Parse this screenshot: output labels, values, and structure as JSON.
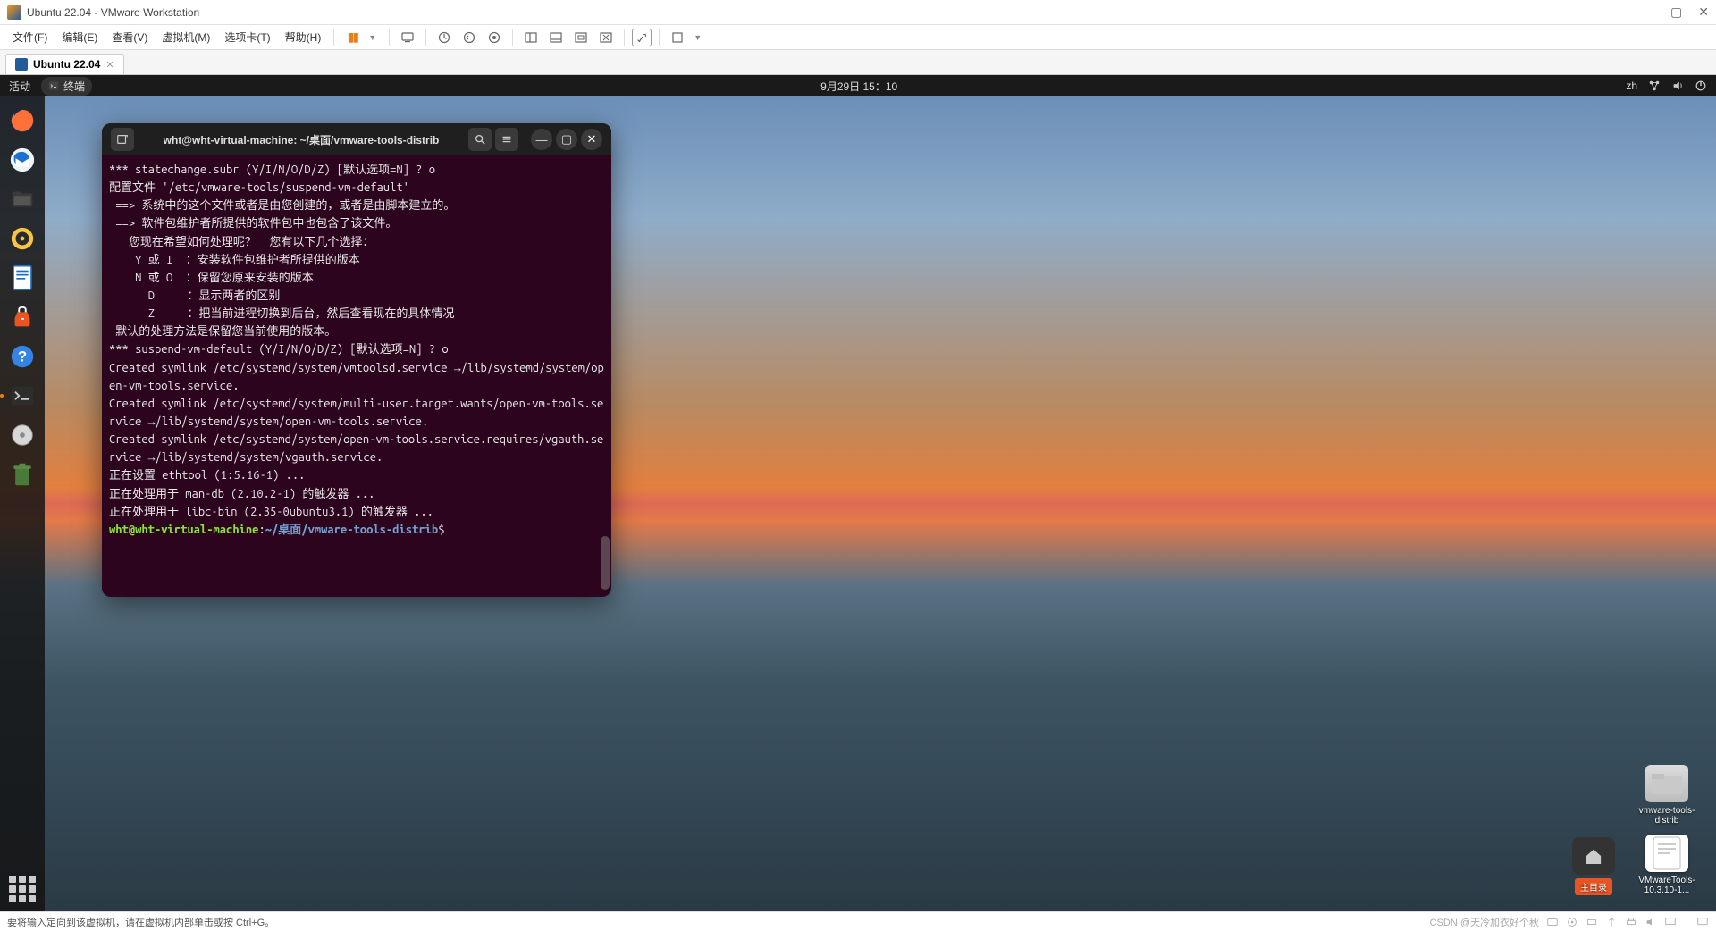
{
  "vmware": {
    "title": "Ubuntu 22.04 - VMware Workstation",
    "menu": {
      "file": "文件(F)",
      "edit": "编辑(E)",
      "view": "查看(V)",
      "vm": "虚拟机(M)",
      "tabs": "选项卡(T)",
      "help": "帮助(H)"
    },
    "tab": {
      "label": "Ubuntu 22.04"
    },
    "status": "要将输入定向到该虚拟机，请在虚拟机内部单击或按 Ctrl+G。",
    "watermark": "CSDN @天冷加衣好个秋"
  },
  "ubuntu": {
    "topbar": {
      "activities": "活动",
      "app": "终端",
      "datetime": "9月29日 15：10",
      "lang": "zh"
    },
    "desktop": {
      "folder1": "vmware-tools-distrib",
      "home": "主目录",
      "file1": "VMwareTools-10.3.10-1..."
    }
  },
  "terminal": {
    "title": "wht@wht-virtual-machine: ~/桌面/vmware-tools-distrib",
    "lines": [
      "*** statechange.subr (Y/I/N/O/D/Z) [默认选项=N] ? o",
      "",
      "配置文件 '/etc/vmware-tools/suspend-vm-default'",
      " ==> 系统中的这个文件或者是由您创建的，或者是由脚本建立的。",
      " ==> 软件包维护者所提供的软件包中也包含了该文件。",
      "   您现在希望如何处理呢？  您有以下几个选择：",
      "    Y 或 I  ：安装软件包维护者所提供的版本",
      "    N 或 O  ：保留您原来安装的版本",
      "      D     ：显示两者的区别",
      "      Z     ：把当前进程切换到后台，然后查看现在的具体情况",
      " 默认的处理方法是保留您当前使用的版本。",
      "*** suspend-vm-default (Y/I/N/O/D/Z) [默认选项=N] ? o",
      "Created symlink /etc/systemd/system/vmtoolsd.service →/lib/systemd/system/open-vm-tools.service.",
      "Created symlink /etc/systemd/system/multi-user.target.wants/open-vm-tools.service →/lib/systemd/system/open-vm-tools.service.",
      "Created symlink /etc/systemd/system/open-vm-tools.service.requires/vgauth.service →/lib/systemd/system/vgauth.service.",
      "正在设置 ethtool (1:5.16-1) ...",
      "正在处理用于 man-db (2.10.2-1) 的触发器 ...",
      "正在处理用于 libc-bin (2.35-0ubuntu3.1) 的触发器 ..."
    ],
    "prompt": {
      "user": "wht@wht-virtual-machine",
      "sep": ":",
      "path": "~/桌面/vmware-tools-distrib",
      "sym": "$"
    }
  }
}
